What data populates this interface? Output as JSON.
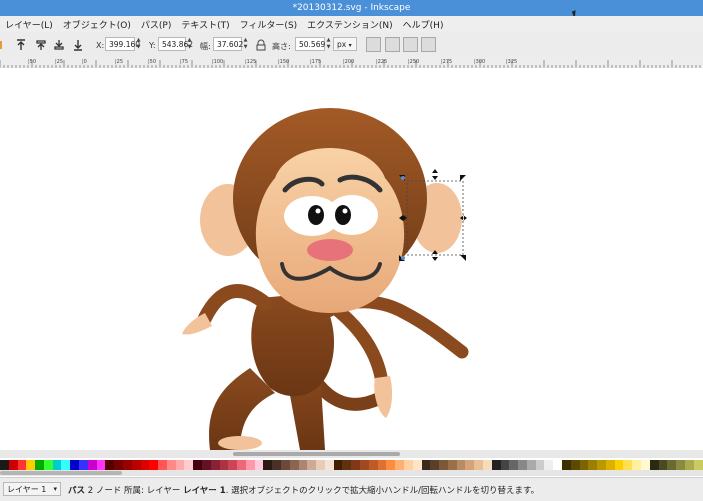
{
  "window": {
    "title": "*20130312.svg - Inkscape"
  },
  "menu": {
    "items": [
      "レイヤー(L)",
      "オブジェクト(O)",
      "パス(P)",
      "テキスト(T)",
      "フィルター(S)",
      "エクステンション(N)",
      "ヘルプ(H)"
    ]
  },
  "toolbar": {
    "x_label": "X:",
    "x_value": "399.160",
    "y_label": "Y:",
    "y_value": "543.862",
    "w_label": "幅:",
    "w_value": "37.602",
    "h_label": "高さ:",
    "h_value": "50.569",
    "unit": "px"
  },
  "ruler": {
    "labels": [
      "|50",
      "|25",
      "|0",
      "|25",
      "|50",
      "|75",
      "|100",
      "|125",
      "|150",
      "|175",
      "|200",
      "|225",
      "|250",
      "|275",
      "|300",
      "|325"
    ]
  },
  "statusbar": {
    "layer": "レイヤー 1",
    "obj_type": "パス",
    "nodes": "2 ノード",
    "location": "所属: レイヤー",
    "layer_name": "レイヤー 1",
    "message": ". 選択オブジェクトのクリックで拡大縮小ハンドル/回転ハンドルを切り替えます。"
  },
  "palette": [
    "#1a1a1a",
    "#cc0000",
    "#ff3333",
    "#ffcc00",
    "#00aa00",
    "#33ff33",
    "#00cccc",
    "#33ffff",
    "#0000cc",
    "#3333ff",
    "#cc00cc",
    "#ff33ff",
    "#550000",
    "#770000",
    "#990000",
    "#bb0000",
    "#dd0000",
    "#ff0000",
    "#ff5555",
    "#ff8888",
    "#ffaaaa",
    "#ffcccc",
    "#440011",
    "#661122",
    "#882233",
    "#aa3344",
    "#cc4455",
    "#ee6677",
    "#ff99aa",
    "#ffccdd",
    "#2b1a14",
    "#4a3128",
    "#6b4a3c",
    "#8c6552",
    "#ad846e",
    "#ceaa94",
    "#e8cbb8",
    "#f5e3d6",
    "#402000",
    "#603010",
    "#803818",
    "#a04820",
    "#c05828",
    "#e07030",
    "#ff8c3c",
    "#ffb070",
    "#ffd0a0",
    "#ffe4c8",
    "#3a2a1a",
    "#5a4028",
    "#7a5838",
    "#9a7048",
    "#ba8a60",
    "#d4a478",
    "#e8c098",
    "#f4dcbc",
    "#222222",
    "#444444",
    "#666666",
    "#888888",
    "#aaaaaa",
    "#cccccc",
    "#eeeeee",
    "#ffffff",
    "#3c3000",
    "#5c4a00",
    "#7c6400",
    "#9c7e00",
    "#bc9800",
    "#dcb200",
    "#fcd000",
    "#ffe050",
    "#fff0a0",
    "#fff8d0",
    "#2a2a10",
    "#4a4a20",
    "#6a6a30",
    "#8a8a40",
    "#aaaa50",
    "#caca60"
  ]
}
